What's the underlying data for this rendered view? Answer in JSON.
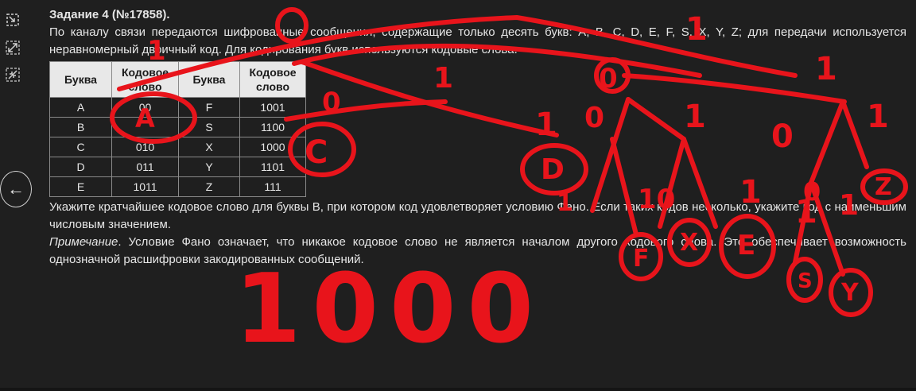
{
  "toolbar": {
    "tools": [
      {
        "icon": "select-area-icon"
      },
      {
        "icon": "expand-diagonal-icon"
      },
      {
        "icon": "collapse-diagonal-icon"
      }
    ],
    "back_label": "←"
  },
  "task": {
    "title": "Задание 4 (№17858).",
    "intro": "По каналу связи передаются шифрованные сообщения, содержащие только десять букв: A, B, C, D, E, F, S, X, Y, Z; для передачи используется неравномерный двоичный код. Для кодирования букв используются кодовые слова.",
    "table": {
      "headers": [
        "Буква",
        "Кодовое слово",
        "Буква",
        "Кодовое слово"
      ],
      "rows": [
        [
          "A",
          "00",
          "F",
          "1001"
        ],
        [
          "B",
          "",
          "S",
          "1100"
        ],
        [
          "C",
          "010",
          "X",
          "1000"
        ],
        [
          "D",
          "011",
          "Y",
          "1101"
        ],
        [
          "E",
          "1011",
          "Z",
          "111"
        ]
      ]
    },
    "question": "Укажите кратчайшее кодовое слово для буквы B, при котором код удовлетворяет условию Фано. Если таких кодов несколько, укажите код с наименьшим числовым значением.",
    "note_label": "Примечание",
    "note_text": ". Условие Фано означает, что никакое кодовое слово не является началом другого кодового слова. Это обеспечивает возможность однозначной расшифровки закодированных сообщений."
  },
  "annotations": {
    "color": "#e8141b",
    "handwritten": [
      "0",
      "1",
      "1",
      "0",
      "1",
      "0",
      "1",
      "0",
      "1",
      "1",
      "1",
      "10",
      "1",
      "1",
      "0",
      "1",
      "1",
      "A",
      "C",
      "D",
      "F",
      "X",
      "E",
      "S",
      "Y",
      "Z",
      "1000"
    ]
  }
}
